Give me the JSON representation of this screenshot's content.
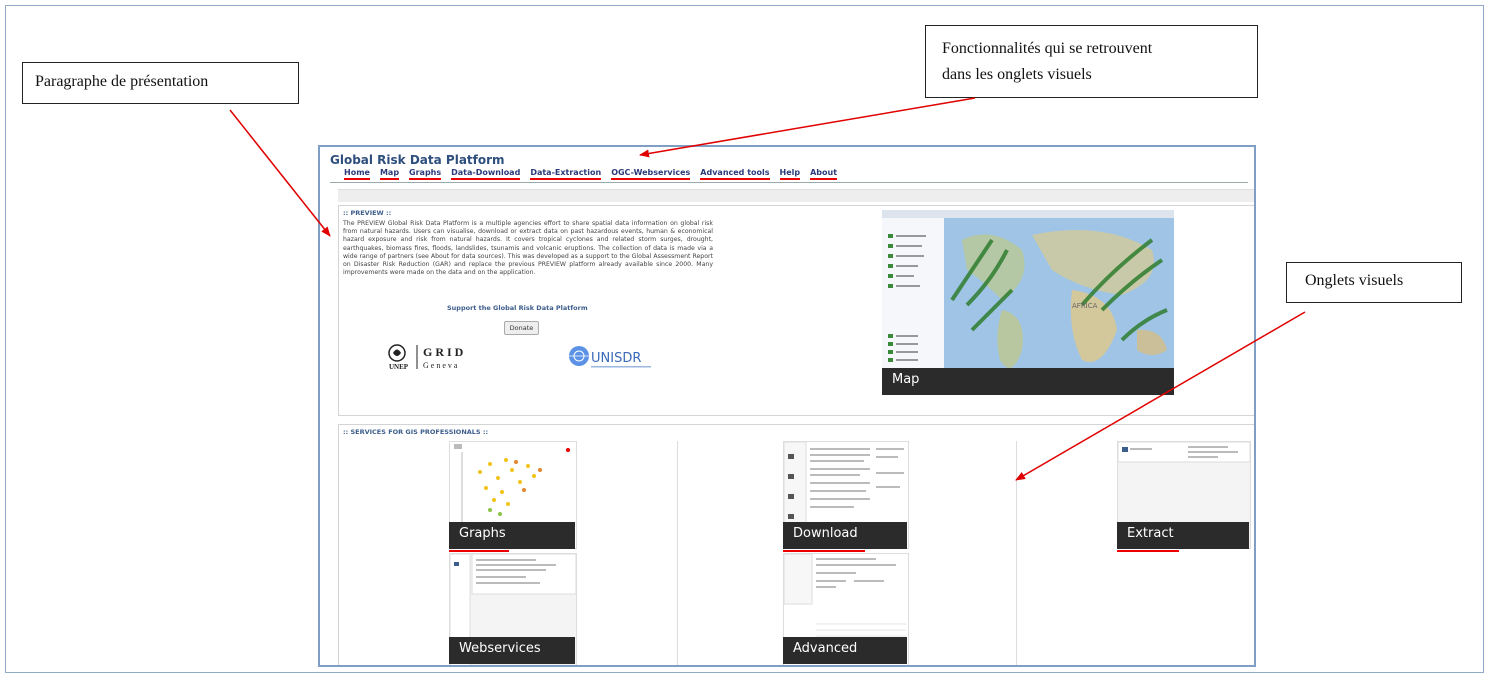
{
  "annotations": {
    "presentation": "Paragraphe de présentation",
    "features": [
      "Fonctionnalités qui se retrouvent",
      "dans les onglets visuels"
    ],
    "visual_tabs": "Onglets visuels"
  },
  "site": {
    "title": "Global Risk Data Platform",
    "nav": [
      "Home",
      "Map",
      "Graphs",
      "Data-Download",
      "Data-Extraction",
      "OGC-Webservices",
      "Advanced tools",
      "Help",
      "About"
    ]
  },
  "preview": {
    "heading": ":: PREVIEW ::",
    "paragraph": "The PREVIEW Global Risk Data Platform is a multiple agencies effort to share spatial data information on global risk from natural hazards. Users can visualise, download or extract data on past hazardous events, human & economical hazard exposure and risk from natural hazards. It covers tropical cyclones and related storm surges, drought, earthquakes, biomass fires, floods, landslides, tsunamis and volcanic eruptions. The collection of data is made via a wide range of partners (see About for data sources). This was developed as a support to the Global Assessment Report on Disaster Risk Reduction (GAR) and replace the previous PREVIEW platform already available since 2000. Many improvements were made on the data and on the application.",
    "support": "Support the Global Risk Data Platform",
    "donate": "Donate",
    "logo_unep": "UNEP",
    "logo_grid": "GRID",
    "logo_geneva": "G e n e v a",
    "logo_unisdr": "UNISDR",
    "map_label": "Map"
  },
  "services": {
    "heading": ":: SERVICES FOR GIS PROFESSIONALS ::",
    "tiles": [
      "Graphs",
      "Download",
      "Extract",
      "Webservices",
      "Advanced"
    ]
  },
  "colors": {
    "annotation_arrow": "#e00000",
    "nav_text": "#2b3b7a",
    "heading": "#3d5e8c",
    "label_bg": "#2b2b2b"
  }
}
